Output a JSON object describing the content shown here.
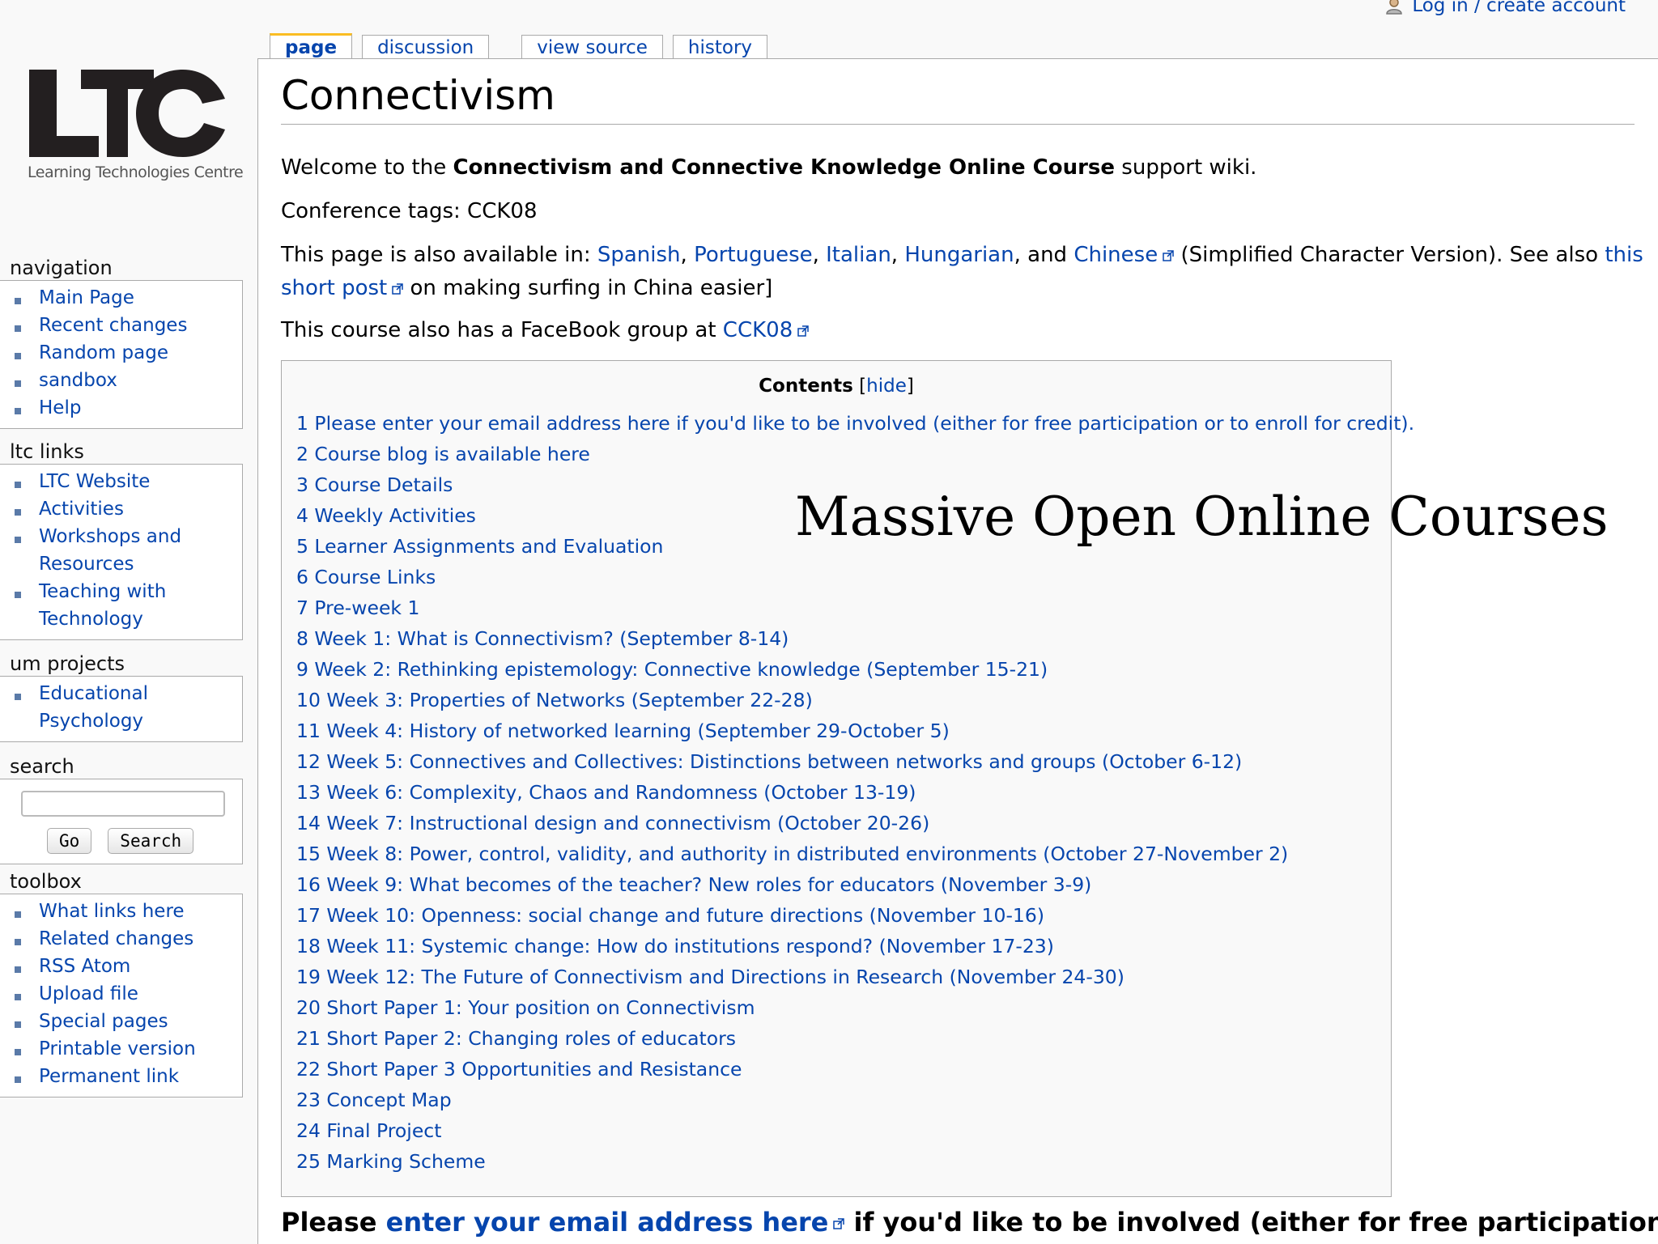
{
  "personal": {
    "login_label": "Log in / create account"
  },
  "tabs": [
    "page",
    "discussion",
    "view source",
    "history"
  ],
  "logo": {
    "text": "LTC",
    "subtitle": "Learning Technologies Centre"
  },
  "sidebar": {
    "navigation": {
      "title": "navigation",
      "items": [
        "Main Page",
        "Recent changes",
        "Random page",
        "sandbox",
        "Help"
      ]
    },
    "ltc_links": {
      "title": "ltc links",
      "items": [
        "LTC Website",
        "Activities",
        "Workshops and Resources",
        "Teaching with Technology"
      ]
    },
    "um_projects": {
      "title": "um projects",
      "items": [
        "Educational Psychology"
      ]
    },
    "search": {
      "title": "search",
      "go_label": "Go",
      "search_label": "Search"
    },
    "toolbox": {
      "title": "toolbox",
      "items": [
        "What links here",
        "Related changes",
        "RSS  Atom",
        "Upload file",
        "Special pages",
        "Printable version",
        "Permanent link"
      ]
    }
  },
  "page": {
    "title": "Connectivism",
    "welcome_pre": "Welcome to the ",
    "welcome_bold": "Connectivism and Connective Knowledge Online Course",
    "welcome_post": " support wiki.",
    "conference_tags": "Conference tags: CCK08",
    "available_pre": "This page is also available in: ",
    "languages": [
      "Spanish",
      "Portuguese",
      "Italian",
      "Hungarian"
    ],
    "and_text": ", and ",
    "chinese": "Chinese",
    "available_mid": " (Simplified Character Version). See also ",
    "short_post_a": "this",
    "short_post_b": "short post",
    "available_post": " on making surfing in China easier]",
    "facebook_pre": "This course also has a FaceBook group at ",
    "facebook_link": "CCK08"
  },
  "toc": {
    "title": "Contents",
    "hide_label": "hide",
    "items": [
      "1 Please enter your email address here if you'd like to be involved (either for free participation or to enroll for credit).",
      "2 Course blog is available here",
      "3 Course Details",
      "4 Weekly Activities",
      "5 Learner Assignments and Evaluation",
      "6 Course Links",
      "7 Pre-week 1",
      "8 Week 1: What is Connectivism? (September 8-14)",
      "9 Week 2: Rethinking epistemology: Connective knowledge (September 15-21)",
      "10 Week 3: Properties of Networks (September 22-28)",
      "11 Week 4: History of networked learning (September 29-October 5)",
      "12 Week 5: Connectives and Collectives: Distinctions between networks and groups (October 6-12)",
      "13 Week 6: Complexity, Chaos and Randomness (October 13-19)",
      "14 Week 7: Instructional design and connectivism (October 20-26)",
      "15 Week 8: Power, control, validity, and authority in distributed environments (October 27-November 2)",
      "16 Week 9: What becomes of the teacher? New roles for educators (November 3-9)",
      "17 Week 10: Openness: social change and future directions (November 10-16)",
      "18 Week 11: Systemic change: How do institutions respond? (November 17-23)",
      "19 Week 12: The Future of Connectivism and Directions in Research (November 24-30)",
      "20 Short Paper 1: Your position on Connectivism",
      "21 Short Paper 2: Changing roles of educators",
      "22 Short Paper 3 Opportunities and Resistance",
      "23 Concept Map",
      "24 Final Project",
      "25 Marking Scheme"
    ]
  },
  "section": {
    "pre": "Please ",
    "link": "enter your email address here",
    "post": " if you'd like to be involved (either for free participation or"
  },
  "overlay": {
    "text": "Massive Open Online Courses"
  },
  "colors": {
    "link": "#0645ad",
    "tab_accent": "#fabd23",
    "border": "#aaaaaa"
  }
}
